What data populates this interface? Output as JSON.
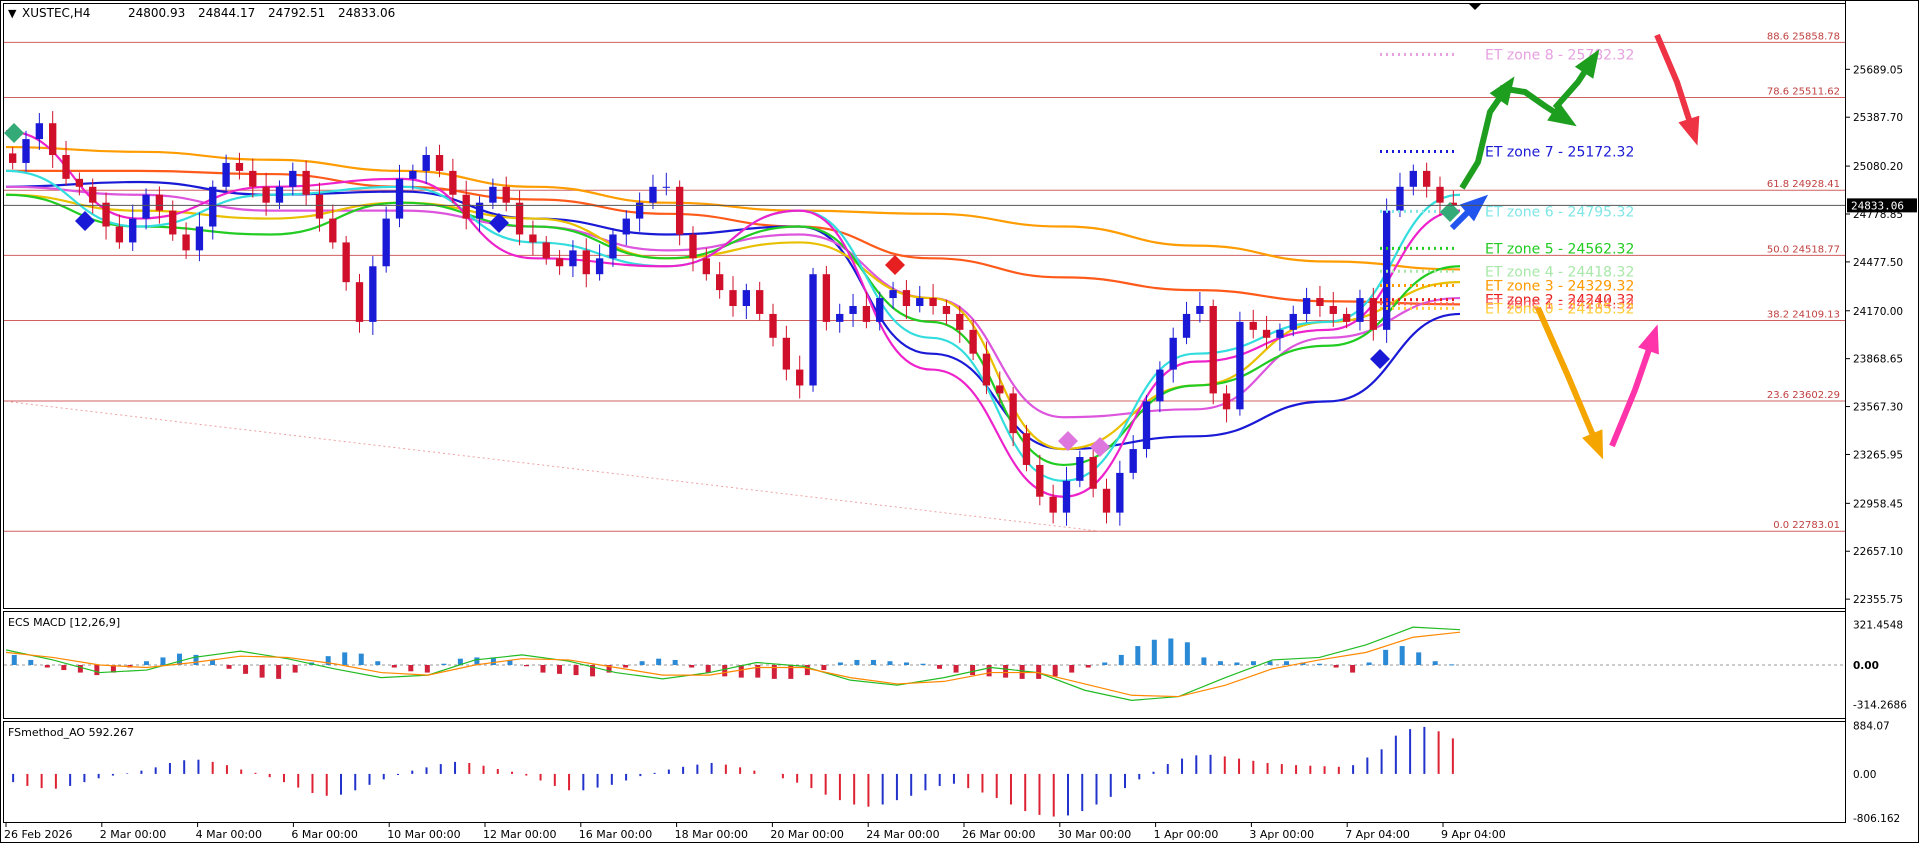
{
  "chart_data": {
    "type": "candlestick",
    "symbol_header": "XUSTEC,H4",
    "ohlc": [
      "24800.93",
      "24844.17",
      "24792.51",
      "24833.06"
    ],
    "current_price": 24833.06,
    "main_ylim": [
      22300,
      26100
    ],
    "price_ticks": [
      "25689.05",
      "25387.70",
      "25080.20",
      "24778.85",
      "24477.50",
      "24170.00",
      "23868.65",
      "23567.30",
      "23265.95",
      "22958.45",
      "22657.10",
      "22355.75"
    ],
    "current_price_label": "24833.06",
    "time_ticks": [
      "26 Feb 2026",
      "2 Mar 00:00",
      "4 Mar 00:00",
      "6 Mar 00:00",
      "10 Mar 00:00",
      "12 Mar 00:00",
      "16 Mar 00:00",
      "18 Mar 00:00",
      "20 Mar 00:00",
      "24 Mar 00:00",
      "26 Mar 00:00",
      "30 Mar 00:00",
      "1 Apr 00:00",
      "3 Apr 00:00",
      "7 Apr 04:00",
      "9 Apr 04:00"
    ],
    "fib_levels": [
      {
        "ratio": "88.6",
        "price": 25858.78,
        "label": "88.6 25858.78"
      },
      {
        "ratio": "78.6",
        "price": 25511.62,
        "label": "78.6 25511.62"
      },
      {
        "ratio": "61.8",
        "price": 24928.41,
        "label": "61.8 24928.41"
      },
      {
        "ratio": "50.0",
        "price": 24518.77,
        "label": "50.0 24518.77"
      },
      {
        "ratio": "38.2",
        "price": 24109.13,
        "label": "38.2 24109.13"
      },
      {
        "ratio": "23.6",
        "price": 23602.29,
        "label": "23.6 23602.29"
      },
      {
        "ratio": "0.0",
        "price": 22783.01,
        "label": "0.0 22783.01"
      }
    ],
    "et_zones": [
      {
        "label": "ET zone 8 - 25782.32",
        "price": 25782.32,
        "color": "#e6a0e0"
      },
      {
        "label": "ET zone 7 - 25172.32",
        "price": 25172.32,
        "color": "#1a1ad6"
      },
      {
        "label": "ET zone 6 - 24795.32",
        "price": 24795.32,
        "color": "#7fe6e6"
      },
      {
        "label": "ET zone 5 - 24562.32",
        "price": 24562.32,
        "color": "#22cc22"
      },
      {
        "label": "ET zone 4 - 24418.32",
        "price": 24418.32,
        "color": "#a8e8a8"
      },
      {
        "label": "ET zone 3 - 24329.32",
        "price": 24329.32,
        "color": "#ff9900"
      },
      {
        "label": "ET zone 2 - 24240.32",
        "price": 24240.32,
        "color": "#e62020"
      },
      {
        "label": "ET zone 1 - 24214.32",
        "price": 24214.32,
        "color": "#ff6060"
      },
      {
        "label": "ET zone 0 - 24185.32",
        "price": 24185.32,
        "color": "#ffcc33"
      }
    ],
    "closes": [
      25100,
      25250,
      25350,
      25150,
      25000,
      24950,
      24850,
      24700,
      24600,
      24750,
      24900,
      24800,
      24650,
      24550,
      24700,
      24950,
      25100,
      25050,
      24950,
      24850,
      24950,
      25050,
      24900,
      24750,
      24600,
      24350,
      24100,
      24450,
      24750,
      25000,
      25050,
      25150,
      25050,
      24900,
      24750,
      24850,
      24950,
      24850,
      24650,
      24600,
      24500,
      24450,
      24550,
      24400,
      24500,
      24650,
      24750,
      24850,
      24950,
      24950,
      24650,
      24500,
      24400,
      24300,
      24200,
      24300,
      24150,
      24000,
      23800,
      23700,
      24400,
      24100,
      24150,
      24200,
      24100,
      24250,
      24300,
      24200,
      24250,
      24200,
      24150,
      24050,
      23900,
      23700,
      23650,
      23400,
      23200,
      23000,
      22900,
      23100,
      23250,
      23050,
      22900,
      23150,
      23300,
      23600,
      23800,
      24000,
      24150,
      24200,
      23650,
      23550,
      24100,
      24050,
      24000,
      24050,
      24150,
      24250,
      24200,
      24150,
      24100,
      24250,
      24050,
      24800,
      24950,
      25050,
      24950,
      24850,
      24833
    ],
    "ma_series": [
      {
        "name": "MA-orange-slow",
        "color": "#ff9c00",
        "values": [
          25200,
          25170,
          25120,
          25050,
          24950,
          24850,
          24800,
          24780,
          24700,
          24580,
          24480,
          24430
        ]
      },
      {
        "name": "MA-red-slow",
        "color": "#ff5a1a",
        "values": [
          25050,
          25050,
          25030,
          24950,
          24870,
          24780,
          24700,
          24500,
          24380,
          24300,
          24230,
          24210
        ]
      },
      {
        "name": "MA-blue",
        "color": "#1a1ad6",
        "values": [
          24950,
          24980,
          24900,
          24920,
          24750,
          24650,
          24700,
          23900,
          23300,
          23380,
          23600,
          24150
        ]
      },
      {
        "name": "MA-violet",
        "color": "#dd55dd",
        "values": [
          24950,
          24900,
          24800,
          24800,
          24700,
          24550,
          24650,
          24250,
          23500,
          23550,
          24000,
          24250
        ]
      },
      {
        "name": "MA-yellow",
        "color": "#e8c000",
        "values": [
          24900,
          24800,
          24750,
          24850,
          24750,
          24500,
          24600,
          24250,
          23300,
          23700,
          24100,
          24350
        ]
      },
      {
        "name": "MA-green",
        "color": "#22cc22",
        "values": [
          24900,
          24700,
          24650,
          24850,
          24700,
          24500,
          24700,
          24100,
          23200,
          23700,
          23950,
          24450
        ]
      },
      {
        "name": "MA-cyan",
        "color": "#33dddd",
        "values": [
          25050,
          24700,
          24900,
          24950,
          24600,
          24450,
          24800,
          24000,
          23100,
          23900,
          24100,
          24900
        ]
      },
      {
        "name": "MA-magenta",
        "color": "#ee22cc",
        "values": [
          25300,
          24750,
          24950,
          25000,
          24500,
          24450,
          24800,
          23800,
          23000,
          23850,
          24050,
          24800
        ]
      }
    ],
    "macd": {
      "title": "ECS MACD [12,26,9]",
      "ticks": [
        "321.4548",
        "0.00",
        "-314.2686"
      ],
      "ylim": [
        -420,
        420
      ],
      "hist": [
        80,
        40,
        -20,
        -40,
        -60,
        -80,
        -60,
        -20,
        30,
        60,
        90,
        80,
        40,
        -30,
        -70,
        -100,
        -110,
        -60,
        20,
        70,
        100,
        90,
        30,
        -20,
        -50,
        -60,
        10,
        50,
        60,
        60,
        40,
        -10,
        -60,
        -70,
        -80,
        -90,
        -60,
        -20,
        30,
        50,
        40,
        -20,
        -60,
        -90,
        -100,
        -100,
        -110,
        -110,
        -80,
        -40,
        20,
        40,
        40,
        30,
        20,
        10,
        -30,
        -60,
        -80,
        -90,
        -100,
        -110,
        -110,
        -90,
        -60,
        -20,
        20,
        80,
        150,
        200,
        210,
        180,
        60,
        30,
        20,
        30,
        30,
        30,
        20,
        10,
        -20,
        -60,
        20,
        120,
        150,
        100,
        30,
        5
      ],
      "macd_line": [
        120,
        40,
        -60,
        -40,
        60,
        110,
        50,
        -30,
        -100,
        -80,
        40,
        80,
        30,
        -60,
        -110,
        -60,
        20,
        -10,
        -120,
        -160,
        -100,
        -20,
        -60,
        -200,
        -280,
        -250,
        -100,
        40,
        60,
        160,
        300,
        280
      ],
      "signal_line": [
        100,
        60,
        0,
        -20,
        20,
        70,
        60,
        10,
        -60,
        -80,
        0,
        50,
        40,
        -20,
        -80,
        -80,
        -20,
        -20,
        -100,
        -150,
        -130,
        -60,
        -60,
        -150,
        -240,
        -250,
        -160,
        -30,
        40,
        100,
        220,
        260
      ]
    },
    "ao": {
      "title": "FSmethod_AO 592.267",
      "ticks": [
        "884.07",
        "0.00",
        "-806.162"
      ],
      "ylim": [
        -880,
        950
      ],
      "values": [
        -150,
        -220,
        -260,
        -270,
        -220,
        -150,
        -80,
        -30,
        10,
        60,
        120,
        200,
        250,
        260,
        220,
        160,
        80,
        20,
        -60,
        -150,
        -250,
        -350,
        -400,
        -380,
        -300,
        -200,
        -100,
        -20,
        60,
        120,
        180,
        220,
        200,
        150,
        90,
        40,
        -30,
        -120,
        -220,
        -300,
        -300,
        -250,
        -200,
        -120,
        -40,
        20,
        80,
        130,
        170,
        200,
        170,
        120,
        60,
        0,
        -80,
        -160,
        -260,
        -380,
        -480,
        -560,
        -600,
        -560,
        -480,
        -400,
        -300,
        -220,
        -180,
        -260,
        -340,
        -440,
        -560,
        -680,
        -750,
        -780,
        -760,
        -680,
        -560,
        -420,
        -260,
        -100,
        40,
        180,
        280,
        340,
        350,
        320,
        280,
        240,
        200,
        180,
        160,
        150,
        140,
        130,
        160,
        300,
        450,
        700,
        820,
        860,
        780,
        650
      ]
    }
  }
}
